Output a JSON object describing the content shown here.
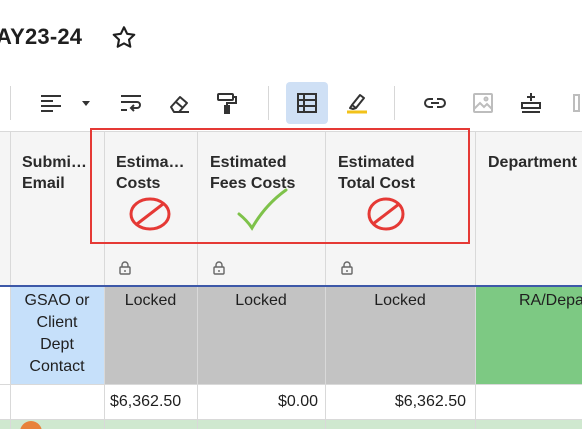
{
  "sheet": {
    "title": "AY23-24"
  },
  "headers": {
    "submitter": [
      "Submi…",
      "Email"
    ],
    "estimated_costs": [
      "Estima…",
      "Costs"
    ],
    "estimated_fees_costs": [
      "Estimated",
      "Fees Costs"
    ],
    "estimated_total_cost": [
      "Estimated",
      "Total Cost"
    ],
    "department": [
      "Department"
    ]
  },
  "row1": {
    "submitter_lines": [
      "GSAO or",
      "Client",
      "Dept",
      "Contact"
    ],
    "estimated_costs": "Locked",
    "estimated_fees_costs": "Locked",
    "estimated_total_cost": "Locked",
    "department": "RA/Depa"
  },
  "row2": {
    "estimated_costs": "$6,362.50",
    "estimated_fees_costs": "$0.00",
    "estimated_total_cost": "$6,362.50"
  },
  "colors": {
    "locked_fill": "#c3c3c3",
    "submitter_fill": "#c6e0fa",
    "department_fill": "#7dc983",
    "annotation_red": "#e53935",
    "annotation_green": "#7ec24a",
    "active_tool": "#cfe0f5"
  },
  "icons": {
    "title": "star-icon",
    "toolbar": [
      "align-left-icon",
      "chevron-down-icon",
      "wrap-text-icon",
      "eraser-icon",
      "format-painter-icon",
      "table-grid-icon",
      "highlighter-icon",
      "link-icon",
      "image-icon",
      "insert-row-icon"
    ],
    "header_locks": [
      "lock-icon",
      "lock-icon",
      "lock-icon"
    ],
    "annotations": [
      "prohibited-icon",
      "checkmark-icon",
      "prohibited-icon"
    ]
  }
}
